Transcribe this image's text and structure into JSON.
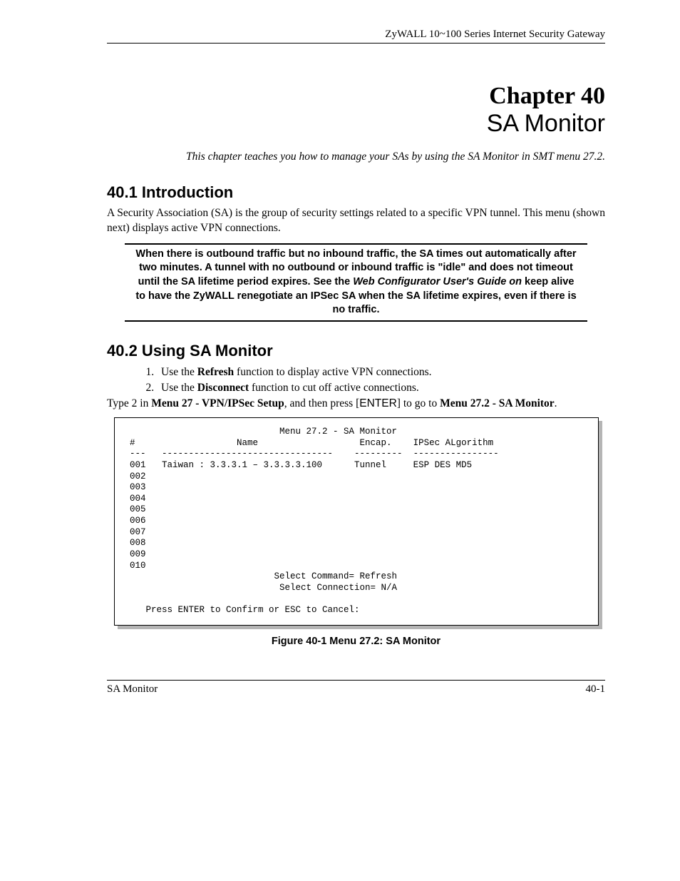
{
  "header": {
    "running": "ZyWALL 10~100 Series Internet Security Gateway"
  },
  "chapter": {
    "label": "Chapter 40",
    "title": "SA Monitor",
    "intro": "This chapter teaches you how to manage your SAs by using the SA Monitor in SMT menu 27.2."
  },
  "section1": {
    "heading": "40.1  Introduction",
    "body": "A Security Association (SA) is the group of security settings related to a specific VPN tunnel. This menu (shown next) displays active VPN connections."
  },
  "note": {
    "part1": "When there is outbound traffic but no inbound traffic, the SA times out automatically after two minutes. A tunnel with no outbound or inbound traffic is \"idle\" and does not timeout until the SA lifetime period expires. See the ",
    "italic": "Web Configurator User's Guide on",
    "part2": " keep alive to have the ZyWALL renegotiate an IPSec SA when the SA lifetime expires, even if there is no traffic."
  },
  "section2": {
    "heading": "40.2  Using SA Monitor",
    "steps": [
      {
        "pre": "Use the ",
        "bold": "Refresh",
        "post": " function to display active VPN connections."
      },
      {
        "pre": "Use the ",
        "bold": "Disconnect",
        "post": " function to cut off active connections."
      }
    ],
    "typeline": {
      "t1": "Type 2 in ",
      "b1": "Menu 27 - VPN/IPSec Setup",
      "t2": ", and then press [",
      "sans": "ENTER",
      "t3": "] to go to ",
      "b2": "Menu 27.2 - SA Monitor",
      "t4": "."
    }
  },
  "terminal": {
    "title": "Menu 27.2 - SA Monitor",
    "headers": {
      "num": "#",
      "name": "Name",
      "encap": "Encap.",
      "algo": "IPSec ALgorithm"
    },
    "divs": {
      "num": "---",
      "name": "--------------------------------",
      "encap": "---------",
      "algo": "----------------"
    },
    "rows": [
      {
        "n": "001",
        "name": "Taiwan : 3.3.3.1 – 3.3.3.3.100",
        "encap": "Tunnel",
        "algo": "ESP DES MD5"
      },
      {
        "n": "002",
        "name": "",
        "encap": "",
        "algo": ""
      },
      {
        "n": "003",
        "name": "",
        "encap": "",
        "algo": ""
      },
      {
        "n": "004",
        "name": "",
        "encap": "",
        "algo": ""
      },
      {
        "n": "005",
        "name": "",
        "encap": "",
        "algo": ""
      },
      {
        "n": "006",
        "name": "",
        "encap": "",
        "algo": ""
      },
      {
        "n": "007",
        "name": "",
        "encap": "",
        "algo": ""
      },
      {
        "n": "008",
        "name": "",
        "encap": "",
        "algo": ""
      },
      {
        "n": "009",
        "name": "",
        "encap": "",
        "algo": ""
      },
      {
        "n": "010",
        "name": "",
        "encap": "",
        "algo": ""
      }
    ],
    "select_command": "Select Command= Refresh",
    "select_connection": "Select Connection= N/A",
    "prompt": "Press ENTER to Confirm or ESC to Cancel:"
  },
  "figure_caption": "Figure 40-1 Menu 27.2: SA Monitor",
  "footer": {
    "left": "SA Monitor",
    "right": "40-1"
  }
}
